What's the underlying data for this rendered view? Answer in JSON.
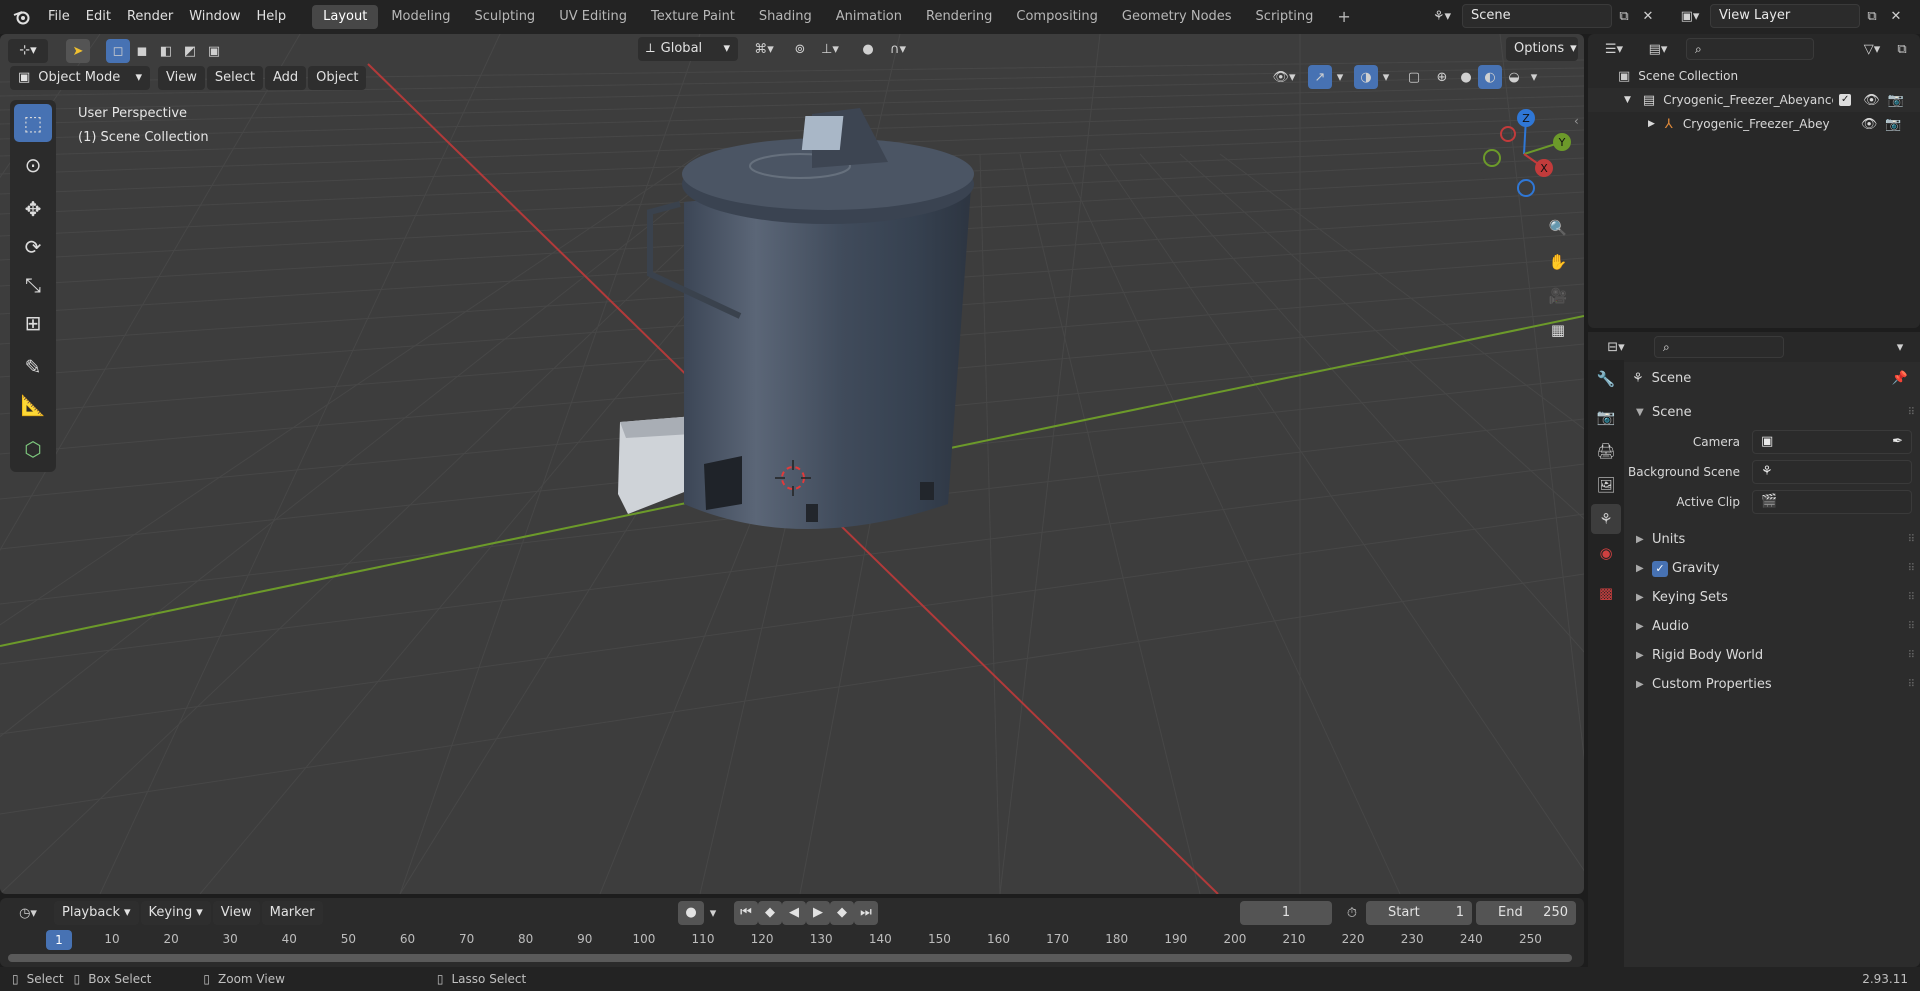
{
  "topbar": {
    "menus": [
      "File",
      "Edit",
      "Render",
      "Window",
      "Help"
    ],
    "workspaces": [
      "Layout",
      "Modeling",
      "Sculpting",
      "UV Editing",
      "Texture Paint",
      "Shading",
      "Animation",
      "Rendering",
      "Compositing",
      "Geometry Nodes",
      "Scripting"
    ],
    "active_workspace": "Layout",
    "add_tab": "+",
    "scene_name": "Scene",
    "view_layer": "View Layer"
  },
  "viewport": {
    "transform_orientation": "Global",
    "options_label": "Options",
    "mode": "Object Mode",
    "menus": [
      "View",
      "Select",
      "Add",
      "Object"
    ],
    "overlay_title": "User Perspective",
    "overlay_subtitle": "(1) Scene Collection",
    "gizmo_axes": {
      "x": "X",
      "y": "Y",
      "z": "Z"
    }
  },
  "outliner": {
    "root": "Scene Collection",
    "items": [
      {
        "label": "Cryogenic_Freezer_Abeyance",
        "type": "collection"
      },
      {
        "label": "Cryogenic_Freezer_Abey",
        "type": "object"
      }
    ]
  },
  "properties": {
    "context": "Scene",
    "panel_title": "Scene",
    "fields": [
      {
        "label": "Camera",
        "value": ""
      },
      {
        "label": "Background Scene",
        "value": ""
      },
      {
        "label": "Active Clip",
        "value": ""
      }
    ],
    "sections": [
      "Units",
      "Gravity",
      "Keying Sets",
      "Audio",
      "Rigid Body World",
      "Custom Properties"
    ],
    "gravity_checked": true
  },
  "timeline": {
    "menus": [
      "Playback",
      "Keying",
      "View",
      "Marker"
    ],
    "current_frame": "1",
    "start_label": "Start",
    "start_value": "1",
    "end_label": "End",
    "end_value": "250",
    "ticks": [
      "10",
      "20",
      "30",
      "40",
      "50",
      "60",
      "70",
      "80",
      "90",
      "100",
      "110",
      "120",
      "130",
      "140",
      "150",
      "160",
      "170",
      "180",
      "190",
      "200",
      "210",
      "220",
      "230",
      "240",
      "250"
    ],
    "playhead": "1"
  },
  "statusbar": {
    "select": "Select",
    "box_select": "Box Select",
    "zoom_view": "Zoom View",
    "lasso_select": "Lasso Select",
    "version": "2.93.11"
  },
  "colors": {
    "accent": "#4772b3",
    "x_axis": "#c23b3b",
    "y_axis": "#6c9a2a",
    "z_axis": "#2f77d6"
  }
}
